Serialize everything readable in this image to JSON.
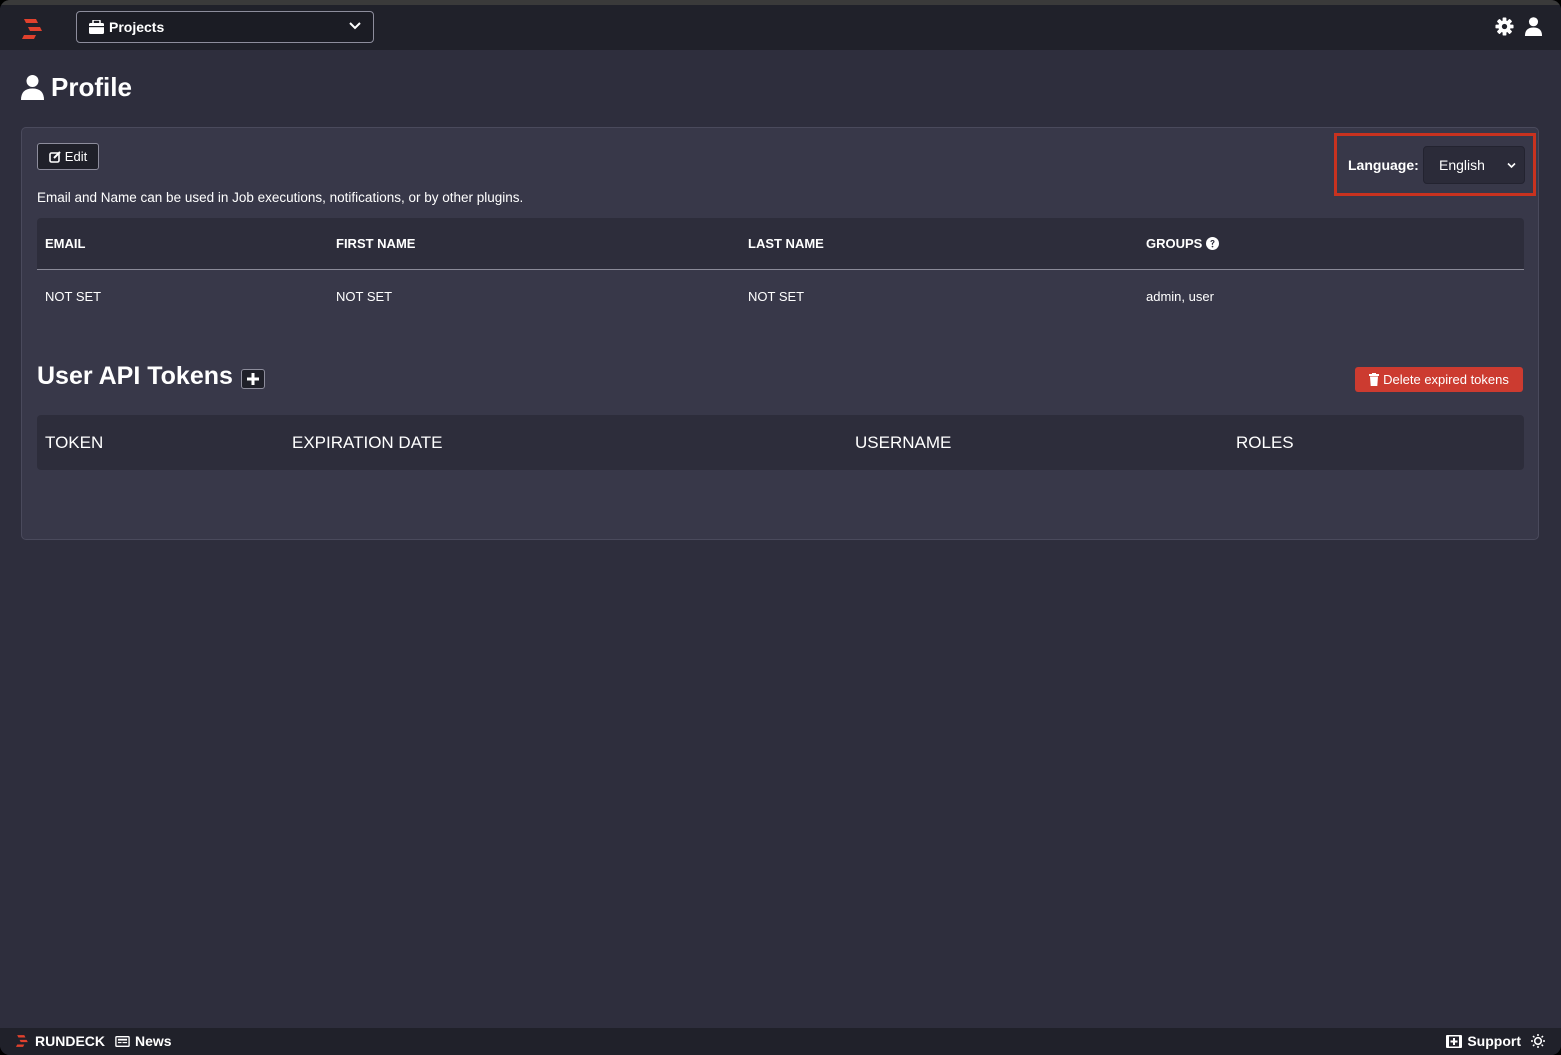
{
  "navbar": {
    "logo": "rundeck-logo-icon",
    "projects_label": "Projects",
    "projects_icon": "briefcase-icon",
    "right_icons": [
      "gear-icon",
      "user-icon"
    ]
  },
  "page": {
    "title": "Profile",
    "title_icon": "user-icon"
  },
  "profile": {
    "edit_label": "Edit",
    "language_label": "Language:",
    "language_value": "English",
    "description": "Email and Name can be used in Job executions, notifications, or by other plugins.",
    "columns": [
      "EMAIL",
      "FIRST NAME",
      "LAST NAME",
      "GROUPS"
    ],
    "row": [
      "NOT SET",
      "NOT SET",
      "NOT SET",
      "admin, user"
    ]
  },
  "tokens": {
    "title": "User API Tokens",
    "delete_label": "Delete expired tokens",
    "columns": [
      "TOKEN",
      "EXPIRATION DATE",
      "USERNAME",
      "ROLES"
    ]
  },
  "footer": {
    "brand": "RUNDECK",
    "news": "News",
    "support": "Support"
  },
  "colors": {
    "accent_red": "#cc3b30",
    "highlight_border": "#c8321f"
  }
}
